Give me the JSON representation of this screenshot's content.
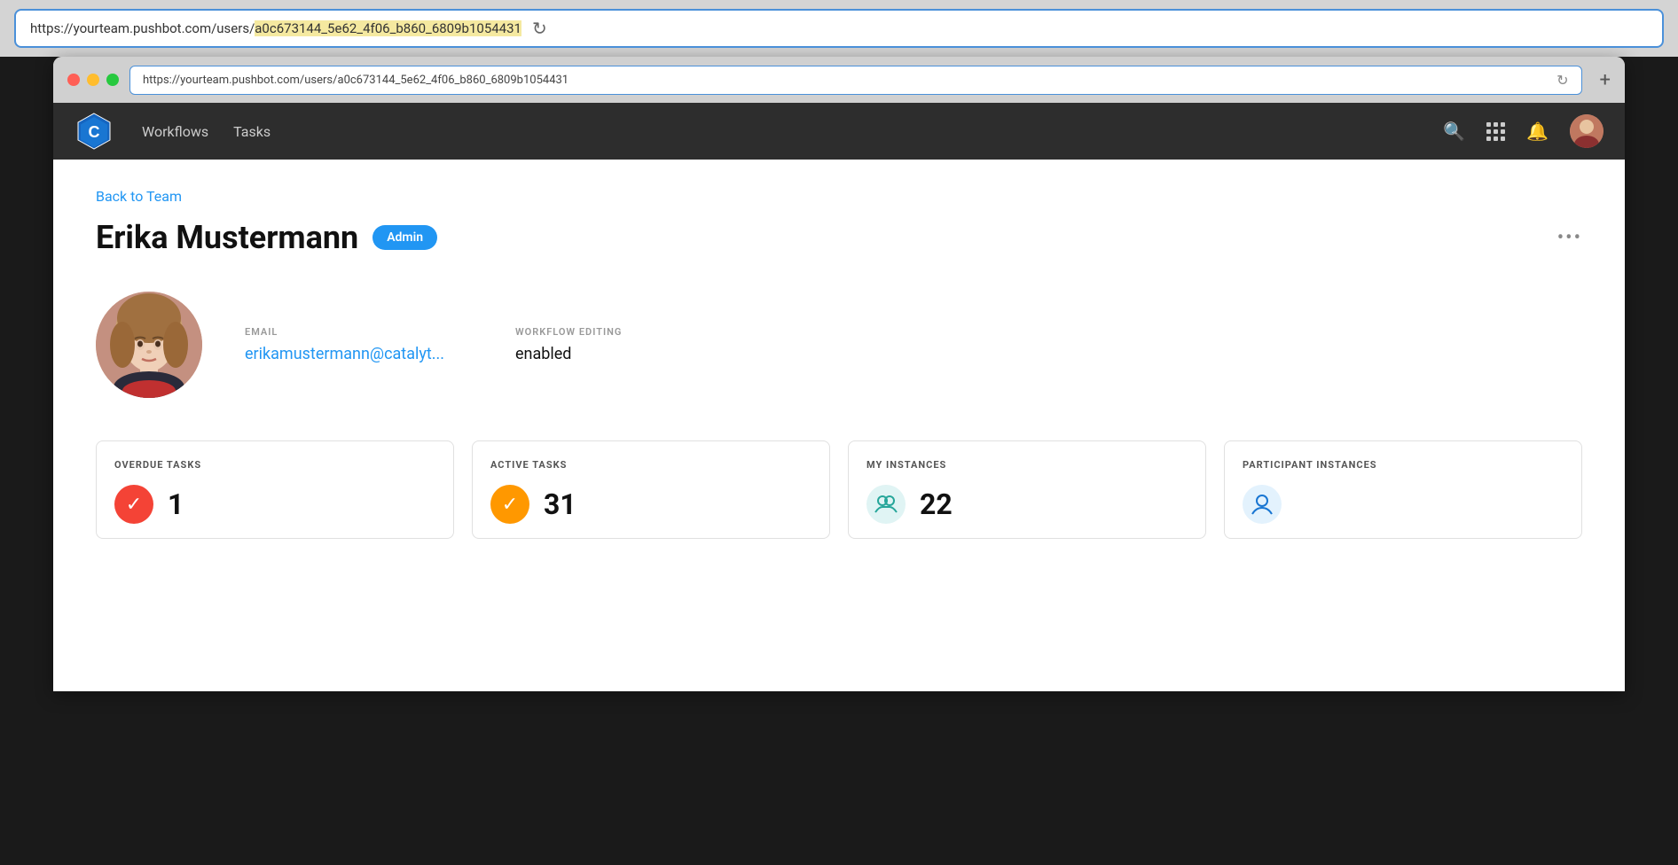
{
  "outer_browser": {
    "url": "https://yourteam.pushbot.com/users/a0c673144_5e62_4f06_b860_6809b1054431",
    "url_normal": "https://yourteam.pushbot.com/users/",
    "url_highlighted": "a0c673144_5e62_4f06_b860_6809b1054431"
  },
  "inner_browser": {
    "url": "https://yourteam.pushbot.com/users/a0c673144_5e62_4f06_b860_6809b1054431"
  },
  "navbar": {
    "workflows_label": "Workflows",
    "tasks_label": "Tasks"
  },
  "page": {
    "back_link": "Back to Team",
    "user_name": "Erika Mustermann",
    "admin_badge": "Admin",
    "more_options": "•••",
    "email_label": "EMAIL",
    "email_value": "erikamustermann@catalyt...",
    "workflow_label": "WORKFLOW EDITING",
    "workflow_value": "enabled",
    "stats": [
      {
        "title": "OVERDUE TASKS",
        "value": "1",
        "icon_type": "red",
        "icon_symbol": "✓"
      },
      {
        "title": "ACTIVE TASKS",
        "value": "31",
        "icon_type": "orange",
        "icon_symbol": "✓"
      },
      {
        "title": "MY INSTANCES",
        "value": "22",
        "icon_type": "teal",
        "icon_symbol": "👥"
      },
      {
        "title": "PARTICIPANT INSTANCES",
        "value": "",
        "icon_type": "blue",
        "icon_symbol": "👤"
      }
    ]
  }
}
